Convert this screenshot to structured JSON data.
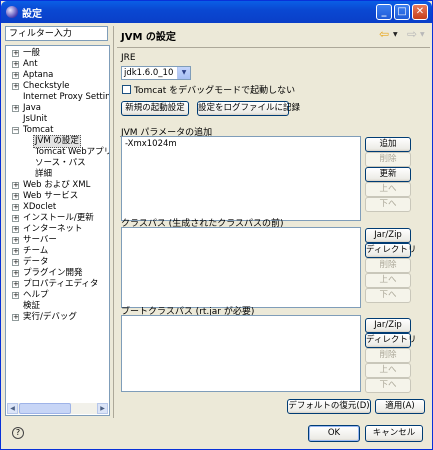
{
  "window": {
    "title": "設定"
  },
  "filter": {
    "text": "フィルター入力"
  },
  "tree": [
    {
      "label": "一般",
      "depth": 0,
      "expander": "+"
    },
    {
      "label": "Ant",
      "depth": 0,
      "expander": "+"
    },
    {
      "label": "Aptana",
      "depth": 0,
      "expander": "+"
    },
    {
      "label": "Checkstyle",
      "depth": 0,
      "expander": "+"
    },
    {
      "label": "Internet Proxy Settings",
      "depth": 0,
      "expander": ""
    },
    {
      "label": "Java",
      "depth": 0,
      "expander": "+"
    },
    {
      "label": "JsUnit",
      "depth": 0,
      "expander": ""
    },
    {
      "label": "Tomcat",
      "depth": 0,
      "expander": "−"
    },
    {
      "label": "JVM の設定",
      "depth": 1,
      "expander": "",
      "selected": true
    },
    {
      "label": "Tomcat Webアプリケーシ",
      "depth": 1,
      "expander": ""
    },
    {
      "label": "ソース・パス",
      "depth": 1,
      "expander": ""
    },
    {
      "label": "詳細",
      "depth": 1,
      "expander": ""
    },
    {
      "label": "Web および XML",
      "depth": 0,
      "expander": "+"
    },
    {
      "label": "Web サービス",
      "depth": 0,
      "expander": "+"
    },
    {
      "label": "XDoclet",
      "depth": 0,
      "expander": "+"
    },
    {
      "label": "インストール/更新",
      "depth": 0,
      "expander": "+"
    },
    {
      "label": "インターネット",
      "depth": 0,
      "expander": "+"
    },
    {
      "label": "サーバー",
      "depth": 0,
      "expander": "+"
    },
    {
      "label": "チーム",
      "depth": 0,
      "expander": "+"
    },
    {
      "label": "データ",
      "depth": 0,
      "expander": "+"
    },
    {
      "label": "プラグイン開発",
      "depth": 0,
      "expander": "+"
    },
    {
      "label": "プロパティエディタ",
      "depth": 0,
      "expander": "+"
    },
    {
      "label": "ヘルプ",
      "depth": 0,
      "expander": "+"
    },
    {
      "label": "検証",
      "depth": 0,
      "expander": ""
    },
    {
      "label": "実行/デバッグ",
      "depth": 0,
      "expander": "+"
    }
  ],
  "page": {
    "title": "JVM の設定",
    "jre_label": "JRE",
    "jre_value": "jdk1.6.0_10",
    "debug_label": "Tomcat をデバッグモードで起動しない",
    "new_launch": "新規の起動設定",
    "log_settings": "設定をログファイルに記録",
    "jvm_params_label": "JVM パラメータの追加",
    "jvm_params_value": "-Xmx1024m",
    "classpath_label": "クラスパス (生成されたクラスパスの前)",
    "bootclasspath_label": "ブートクラスパス (rt.jar が必要)"
  },
  "buttons": {
    "add": "追加",
    "remove": "削除",
    "update": "更新",
    "up": "上へ",
    "down": "下へ",
    "jar_zip": "Jar/Zip",
    "directory": "ディレクトリ",
    "restore_defaults": "デフォルトの復元(D)",
    "apply": "適用(A)",
    "ok": "OK",
    "cancel": "キャンセル"
  }
}
